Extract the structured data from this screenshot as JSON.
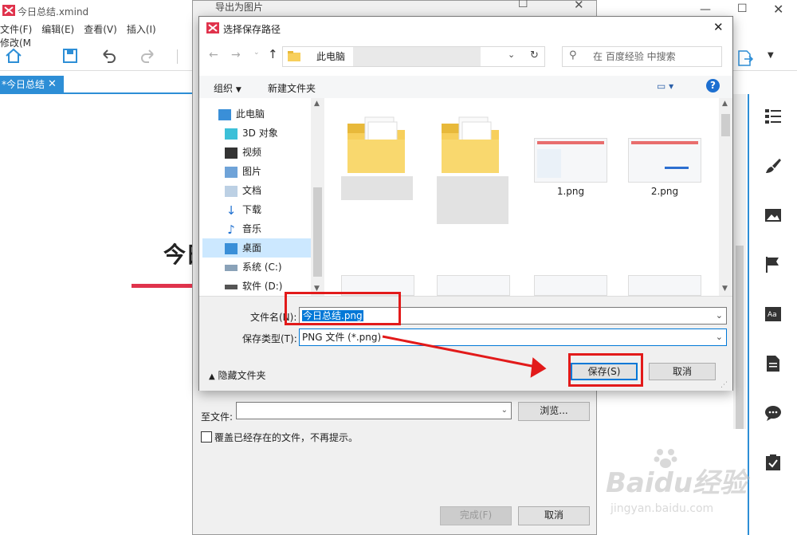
{
  "app": {
    "title": "今日总结.xmind",
    "menu": [
      "文件(F)",
      "编辑(E)",
      "查看(V)",
      "插入(I)",
      "修改(M"
    ],
    "tab_label": "*今日总结",
    "canvas_title": "今日",
    "colors": {
      "accent": "#2d8ed6",
      "underline": "#e0334c"
    }
  },
  "export_dialog": {
    "title": "导出为图片",
    "to_file_label": "至文件:",
    "browse_label": "浏览...",
    "overwrite_label": "覆盖已经存在的文件，不再提示。",
    "finish_label": "完成(F)",
    "cancel_label": "取消"
  },
  "save_dialog": {
    "title": "选择保存路径",
    "address": "此电脑",
    "search_placeholder": "在 百度经验 中搜索",
    "organize_label": "组织",
    "new_folder_label": "新建文件夹",
    "nav_items": [
      {
        "label": "此电脑",
        "icon": "computer-icon"
      },
      {
        "label": "3D 对象",
        "icon": "cube-icon"
      },
      {
        "label": "视频",
        "icon": "video-icon"
      },
      {
        "label": "图片",
        "icon": "picture-icon"
      },
      {
        "label": "文档",
        "icon": "document-icon"
      },
      {
        "label": "下载",
        "icon": "download-icon"
      },
      {
        "label": "音乐",
        "icon": "music-icon"
      },
      {
        "label": "桌面",
        "icon": "desktop-icon"
      },
      {
        "label": "系统 (C:)",
        "icon": "drive-icon"
      },
      {
        "label": "软件 (D:)",
        "icon": "drive-icon"
      }
    ],
    "files": [
      {
        "name": ""
      },
      {
        "name": ""
      },
      {
        "name": "1.png"
      },
      {
        "name": "2.png"
      }
    ],
    "filename_label": "文件名(N):",
    "filename_value": "今日总结.png",
    "filetype_label": "保存类型(T):",
    "filetype_value": "PNG 文件 (*.png)",
    "hide_folders_label": "隐藏文件夹",
    "save_label": "保存(S)",
    "cancel_label": "取消"
  },
  "watermark": {
    "brand": "Baidu经验",
    "url": "jingyan.baidu.com"
  }
}
